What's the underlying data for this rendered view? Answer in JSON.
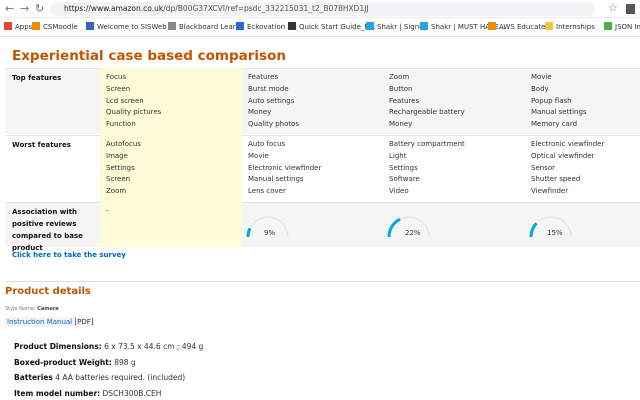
{
  "browser": {
    "url_host": "https://www.amazon.co.uk",
    "url_path": "/dp/B00G37XCVI/ref=psdc_332215031_t2_B078HXD1JJ",
    "bookmarks": [
      {
        "label": "Apps",
        "color": "#e94235"
      },
      {
        "label": "CSMoodle",
        "color": "#f28b00"
      },
      {
        "label": "Welcome to SISWeb",
        "color": "#3366aa"
      },
      {
        "label": "Blackboard Learn",
        "color": "#888888"
      },
      {
        "label": "Eckovation",
        "color": "#1e6fd9"
      },
      {
        "label": "Quick Start Guide_R...",
        "color": "#333333"
      },
      {
        "label": "Shakr | Signup",
        "color": "#2aa3e0"
      },
      {
        "label": "Shakr | MUST HAVE...",
        "color": "#2aa3e0"
      },
      {
        "label": "AWS Educate",
        "color": "#f08c00"
      },
      {
        "label": "Internships",
        "color": "#f4c542"
      },
      {
        "label": "JSON Introdu",
        "color": "#4caf50"
      }
    ]
  },
  "comparison": {
    "title": "Experiential case based comparison",
    "rows": [
      {
        "label": "Top features",
        "columns": [
          [
            "Focus",
            "Screen",
            "Lcd screen",
            "Quality pictures",
            "Function"
          ],
          [
            "Features",
            "Burst mode",
            "Auto settings",
            "Money",
            "Quality photos"
          ],
          [
            "Zoom",
            "Button",
            "Features",
            "Rechargeable battery",
            "Money"
          ],
          [
            "Movie",
            "Body",
            "Popup flash",
            "Manual settings",
            "Memory card"
          ]
        ]
      },
      {
        "label": "Worst features",
        "columns": [
          [
            "Autofocus",
            "Image",
            "Settings",
            "Screen",
            "Zoom"
          ],
          [
            "Auto focus",
            "Movie",
            "Electronic viewfinder",
            "Manual settings",
            "Lens cover"
          ],
          [
            "Battery compartment",
            "Light",
            "Settings",
            "Software",
            "Video"
          ],
          [
            "Electronic viewfinder",
            "Optical viewfinder",
            "Sensor",
            "Shutter speed",
            "Viewfinder"
          ]
        ]
      }
    ],
    "association": {
      "label": "Association with positive reviews compared to base product",
      "base": "-",
      "values": [
        "9%",
        "22%",
        "15%"
      ],
      "percents": [
        9,
        22,
        15
      ]
    },
    "survey_link": "Click here to take the survey",
    "gauge_color": "#00a8e1"
  },
  "product_details": {
    "title": "Product details",
    "style_label": "Style Name:",
    "style_value": "Camera",
    "manual_link": "Instruction Manual",
    "manual_suffix": "[PDF]",
    "items": [
      {
        "k": "Product Dimensions:",
        "v": "6 x 73.5 x 44.6 cm ; 494 g"
      },
      {
        "k": "Boxed-product Weight:",
        "v": "898 g"
      },
      {
        "k": "Batteries",
        "v": "4 AA batteries required. (included)"
      },
      {
        "k": "Item model number:",
        "v": "DSCH300B.CEH"
      }
    ]
  }
}
